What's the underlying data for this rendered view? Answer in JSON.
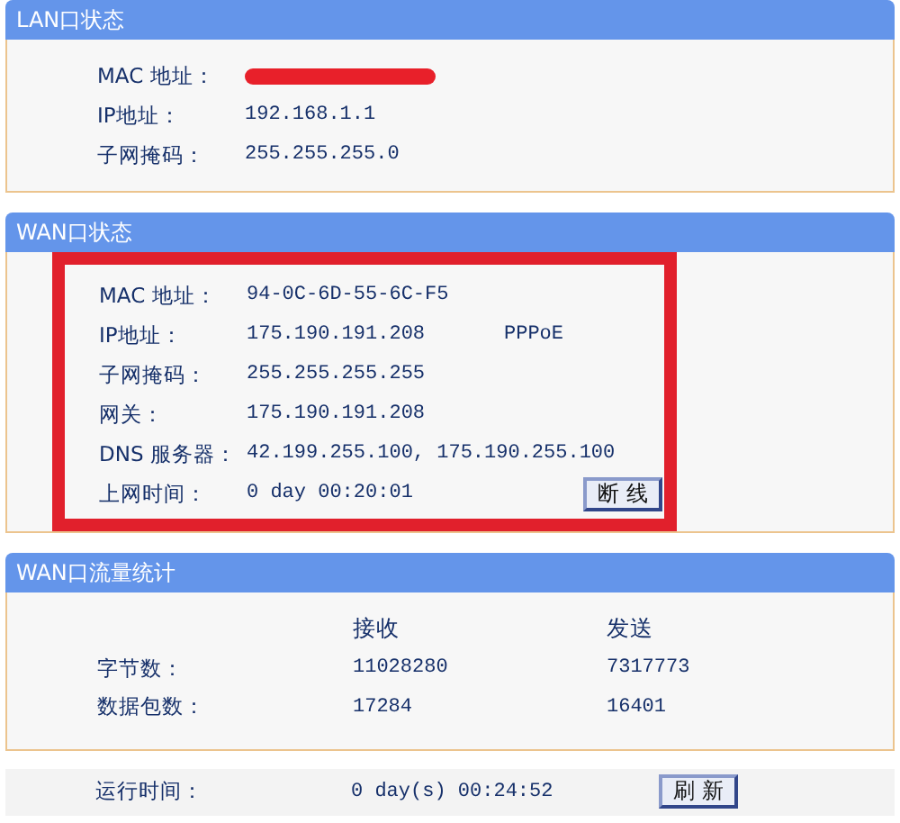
{
  "lan": {
    "title": "LAN口状态",
    "highlighted": false,
    "rows": [
      {
        "label": "MAC 地址：",
        "redacted": true
      },
      {
        "label": "IP地址：",
        "value": "192.168.1.1"
      },
      {
        "label": "子网掩码：",
        "value": "255.255.255.0"
      }
    ]
  },
  "wan": {
    "title": "WAN口状态",
    "highlighted": true,
    "rows": [
      {
        "label": "MAC 地址：",
        "value": "94-0C-6D-55-6C-F5"
      },
      {
        "label": "IP地址：",
        "value": "175.190.191.208",
        "extra": "PPPoE"
      },
      {
        "label": "子网掩码：",
        "value": "255.255.255.255"
      },
      {
        "label": "网关：",
        "value": "175.190.191.208"
      },
      {
        "label": "DNS 服务器：",
        "value": "42.199.255.100, 175.190.255.100"
      },
      {
        "label": "上网时间：",
        "value": "0 day 00:20:01",
        "button": "断 线"
      }
    ]
  },
  "traffic": {
    "title": "WAN口流量统计",
    "columns": [
      "接收",
      "发送"
    ],
    "rows": [
      {
        "label": "字节数：",
        "received": "11028280",
        "sent": "7317773"
      },
      {
        "label": "数据包数：",
        "received": "17284",
        "sent": "16401"
      }
    ]
  },
  "runtime": {
    "label": "运行时间：",
    "value": "0 day(s) 00:24:52",
    "button": "刷 新"
  }
}
